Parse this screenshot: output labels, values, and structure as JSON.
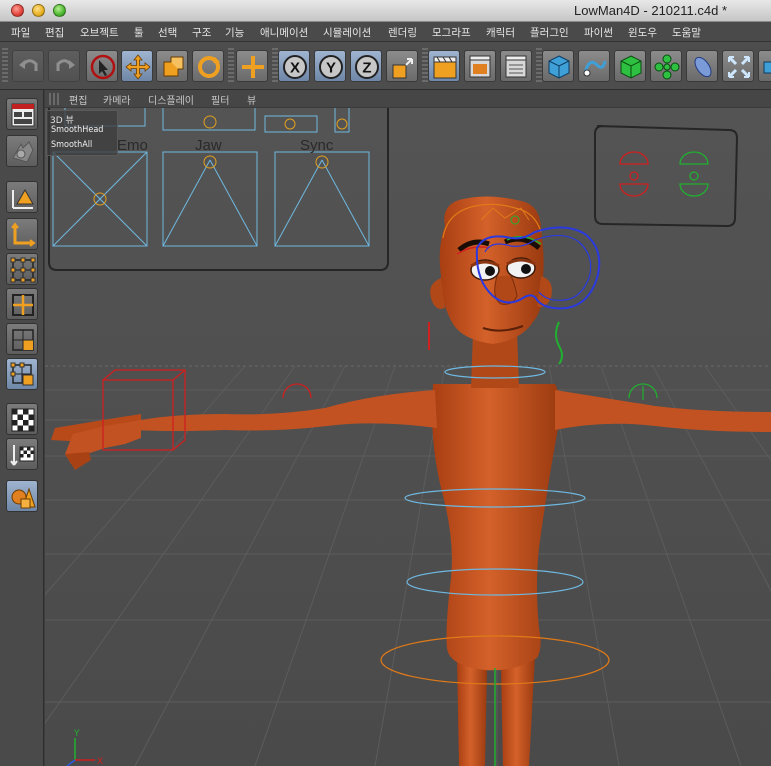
{
  "window": {
    "title": "LowMan4D - 210211.c4d *"
  },
  "menubar": {
    "items": [
      "파일",
      "편집",
      "오브젝트",
      "툴",
      "선택",
      "구조",
      "기능",
      "애니메이션",
      "시뮬레이션",
      "렌더링",
      "모그라프",
      "캐릭터",
      "플러그인",
      "파이썬",
      "윈도우",
      "도움말"
    ]
  },
  "toolbar": {
    "buttons": [
      {
        "name": "undo-icon"
      },
      {
        "name": "redo-icon"
      },
      {
        "name": "live-selection-icon"
      },
      {
        "name": "move-icon"
      },
      {
        "name": "scale-icon"
      },
      {
        "name": "rotate-icon"
      },
      {
        "name": "recent-tool-icon"
      },
      {
        "name": "x-axis-lock-icon",
        "label": "X"
      },
      {
        "name": "y-axis-lock-icon",
        "label": "Y"
      },
      {
        "name": "z-axis-lock-icon",
        "label": "Z"
      },
      {
        "name": "coordinate-system-icon"
      },
      {
        "name": "render-view-icon"
      },
      {
        "name": "render-picture-viewer-icon"
      },
      {
        "name": "render-settings-icon"
      },
      {
        "name": "cube-object-icon"
      },
      {
        "name": "spline-pen-icon"
      },
      {
        "name": "subdivision-surface-icon"
      },
      {
        "name": "array-generator-icon"
      },
      {
        "name": "deformer-icon"
      },
      {
        "name": "environment-icon"
      },
      {
        "name": "camera-icon"
      }
    ]
  },
  "sidebar": {
    "buttons": [
      {
        "name": "model-mode-icon"
      },
      {
        "name": "texture-mode-icon"
      },
      {
        "name": "workplane-icon"
      },
      {
        "name": "axis-mode-icon"
      },
      {
        "name": "points-mode-icon"
      },
      {
        "name": "edges-mode-icon"
      },
      {
        "name": "polygons-mode-icon"
      },
      {
        "name": "uvw-mode-icon"
      },
      {
        "name": "enable-axis-icon"
      },
      {
        "name": "tweak-mode-icon"
      },
      {
        "name": "sculpt-icon"
      }
    ]
  },
  "viewport": {
    "menu": [
      "편집",
      "카메라",
      "디스플레이",
      "필터",
      "뷰"
    ],
    "overlay": {
      "title": "3D 뷰",
      "items": [
        "SmoothHead",
        "SmoothAll"
      ]
    },
    "controls": {
      "labels": [
        "Emo",
        "Jaw",
        "Sync"
      ]
    },
    "axis": {
      "y": "Y",
      "x": "X"
    }
  },
  "colors": {
    "skin": "#c4501d",
    "skin_dark": "#8a3410",
    "control_blue": "#6fb8e0",
    "control_orange": "#e07a18",
    "control_red": "#d02020",
    "control_green": "#20b030",
    "eye_ctrl": "#2a3ae0"
  }
}
